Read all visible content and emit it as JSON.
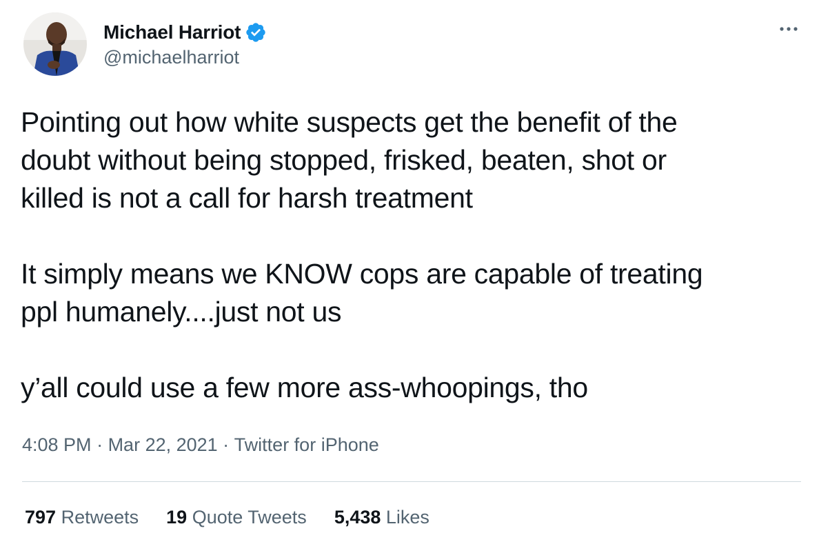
{
  "author": {
    "display_name": "Michael Harriot",
    "handle": "@michaelharriot",
    "verified": true
  },
  "tweet": {
    "paragraphs": [
      "Pointing out how white suspects get the benefit of the\ndoubt without being stopped, frisked, beaten, shot or\nkilled  is not a call for harsh treatment",
      "It simply means we KNOW cops are capable of treating\nppl humanely....just not us",
      "y’all could use a few more ass-whoopings, tho"
    ],
    "time": "4:08 PM",
    "separator": " · ",
    "date": "Mar 22, 2021",
    "source": "Twitter for iPhone"
  },
  "stats": {
    "retweets": {
      "count": "797",
      "label": "Retweets"
    },
    "quote_tweets": {
      "count": "19",
      "label": "Quote Tweets"
    },
    "likes": {
      "count": "5,438",
      "label": "Likes"
    }
  },
  "icons": {
    "verified": "verified-badge-icon",
    "more": "more-dots-icon"
  },
  "colors": {
    "text": "#0f1419",
    "secondary": "#536471",
    "verified_blue": "#1d9bf0",
    "divider": "#cfd9de"
  }
}
